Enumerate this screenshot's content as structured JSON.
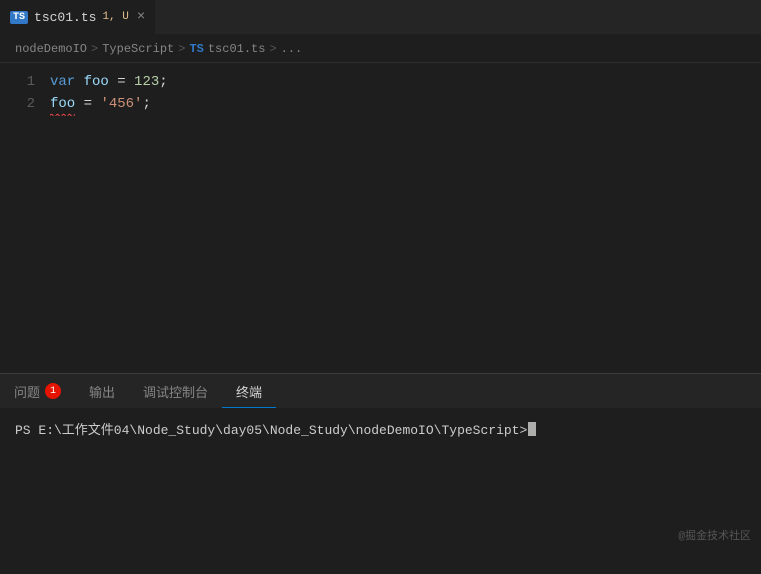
{
  "tab": {
    "ts_icon": "TS",
    "filename": "tsc01.ts",
    "modified_indicator": "1, U",
    "close_label": "×"
  },
  "breadcrumb": {
    "parts": [
      "nodeDemoIO",
      "TypeScript",
      "TS",
      "tsc01.ts",
      "..."
    ],
    "separators": [
      ">",
      ">",
      ">",
      ">"
    ]
  },
  "editor": {
    "lines": [
      {
        "number": "1",
        "tokens": [
          {
            "type": "kw-var",
            "text": "var "
          },
          {
            "type": "kw-identifier",
            "text": "foo"
          },
          {
            "type": "kw-op",
            "text": " = "
          },
          {
            "type": "kw-number",
            "text": "123"
          },
          {
            "type": "kw-op",
            "text": ";"
          }
        ]
      },
      {
        "number": "2",
        "tokens": [
          {
            "type": "kw-error",
            "text": "foo"
          },
          {
            "type": "kw-op",
            "text": " = "
          },
          {
            "type": "kw-string",
            "text": "'456'"
          },
          {
            "type": "kw-op",
            "text": ";"
          }
        ]
      }
    ]
  },
  "panel": {
    "tabs": [
      {
        "label": "问题",
        "badge": "1",
        "active": false
      },
      {
        "label": "输出",
        "badge": "",
        "active": false
      },
      {
        "label": "调试控制台",
        "badge": "",
        "active": false
      },
      {
        "label": "终端",
        "badge": "",
        "active": true
      }
    ]
  },
  "terminal": {
    "prompt": "PS E:\\工作文件04\\Node_Study\\day05\\Node_Study\\nodeDemoIO\\TypeScript>"
  },
  "footer": {
    "watermark": "@掘金技术社区"
  }
}
